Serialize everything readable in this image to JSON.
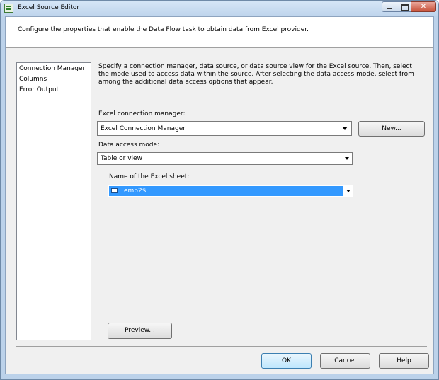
{
  "window": {
    "title": "Excel Source Editor"
  },
  "header": {
    "text": "Configure the properties that enable the Data Flow task to obtain data from Excel provider."
  },
  "nav": {
    "items": [
      "Connection Manager",
      "Columns",
      "Error Output"
    ]
  },
  "description": "Specify a connection manager, data source, or data source view for the Excel source. Then, select the mode used to access data within the source. After selecting the data access mode, select from among the additional data access options that appear.",
  "connection": {
    "label": "Excel connection manager:",
    "value": "Excel Connection Manager",
    "new_label": "New..."
  },
  "mode": {
    "label": "Data access mode:",
    "value": "Table or view"
  },
  "sheet": {
    "label": "Name of the Excel sheet:",
    "value": "emp2$"
  },
  "buttons": {
    "preview": "Preview...",
    "ok": "OK",
    "cancel": "Cancel",
    "help": "Help"
  },
  "icons": {
    "app": "excel-icon",
    "sheet": "table-icon"
  },
  "colors": {
    "selection": "#3399ff",
    "title_bar": "#bed4ec",
    "close_button": "#c8523a"
  }
}
